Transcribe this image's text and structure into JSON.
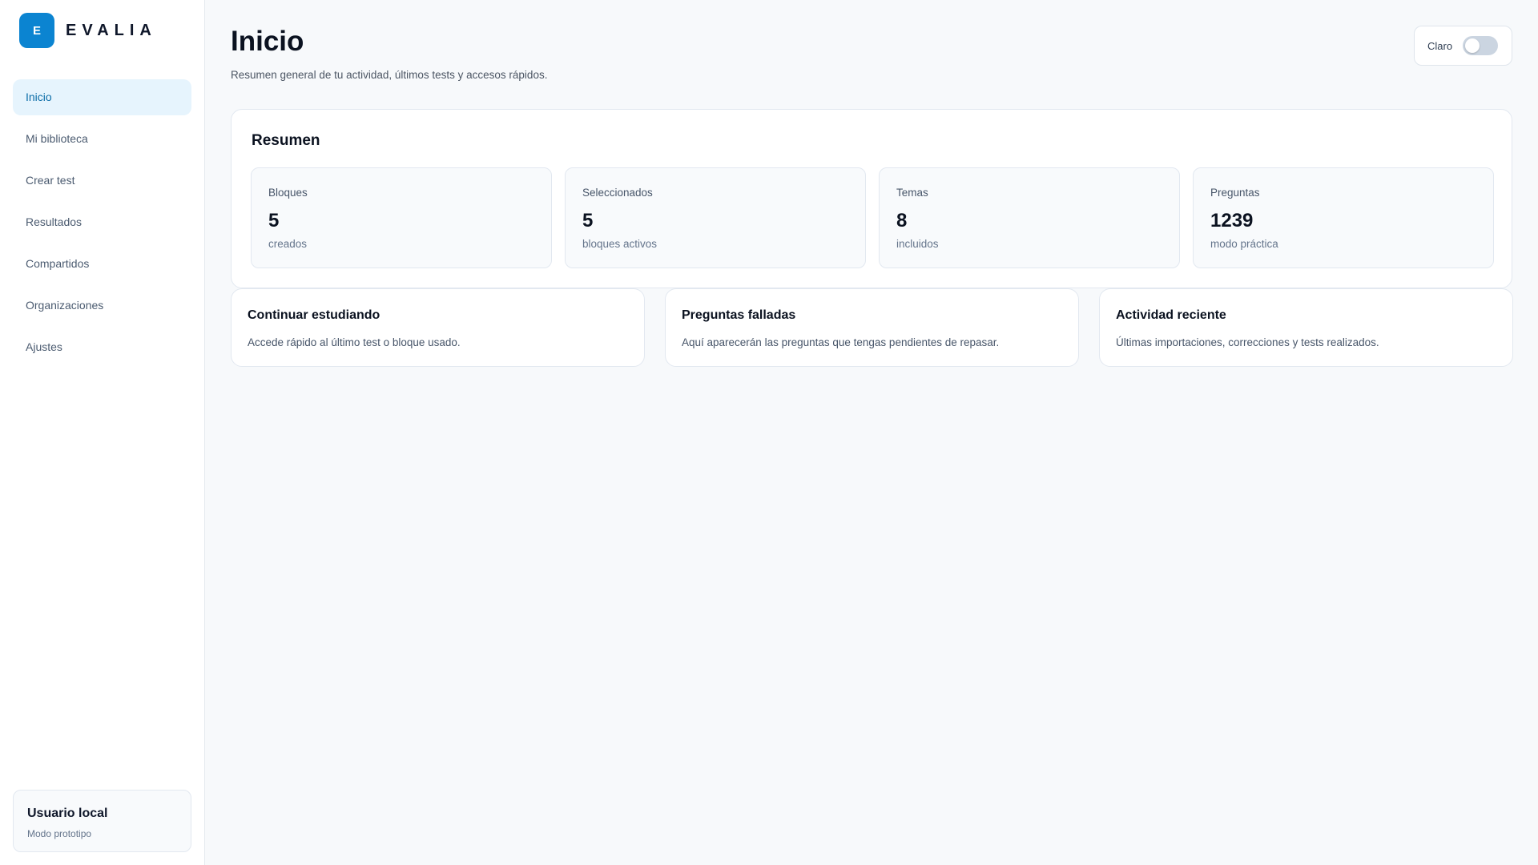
{
  "brand": {
    "logo_letter": "E",
    "name": "EVALIA",
    "accent": "#0b84d1"
  },
  "sidebar": {
    "items": [
      {
        "label": "Inicio",
        "active": true
      },
      {
        "label": "Mi biblioteca",
        "active": false
      },
      {
        "label": "Crear test",
        "active": false
      },
      {
        "label": "Resultados",
        "active": false
      },
      {
        "label": "Compartidos",
        "active": false
      },
      {
        "label": "Organizaciones",
        "active": false
      },
      {
        "label": "Ajustes",
        "active": false
      }
    ],
    "user": {
      "name": "Usuario local",
      "mode": "Modo prototipo"
    }
  },
  "header": {
    "title": "Inicio",
    "subtitle": "Resumen general de tu actividad, últimos tests y accesos rápidos.",
    "theme_toggle": {
      "label": "Claro",
      "enabled": false
    }
  },
  "summary": {
    "title": "Resumen",
    "stats": [
      {
        "label": "Bloques",
        "value": "5",
        "note": "creados"
      },
      {
        "label": "Seleccionados",
        "value": "5",
        "note": "bloques activos"
      },
      {
        "label": "Temas",
        "value": "8",
        "note": "incluidos"
      },
      {
        "label": "Preguntas",
        "value": "1239",
        "note": "modo práctica"
      }
    ]
  },
  "cards": [
    {
      "title": "Continuar estudiando",
      "description": "Accede rápido al último test o bloque usado."
    },
    {
      "title": "Preguntas falladas",
      "description": "Aquí aparecerán las preguntas que tengas pendientes de repasar."
    },
    {
      "title": "Actividad reciente",
      "description": "Últimas importaciones, correcciones y tests realizados."
    }
  ]
}
